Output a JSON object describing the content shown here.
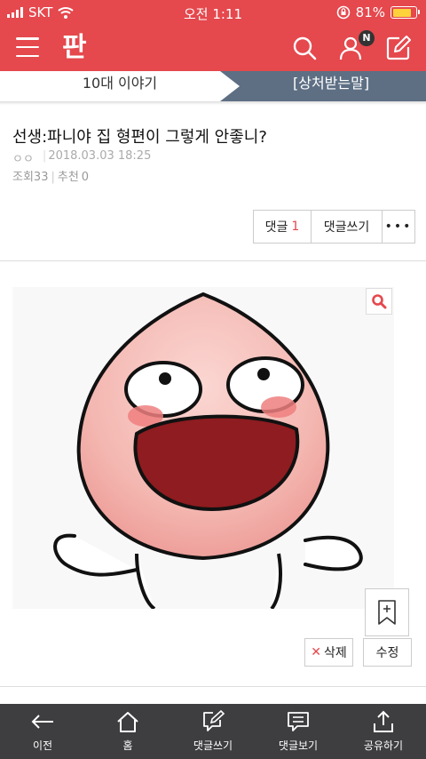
{
  "status_bar": {
    "carrier": "SKT",
    "time": "오전 1:11",
    "battery": "81%",
    "battery_level": 0.81
  },
  "header": {
    "logo": "판",
    "notification_badge": "N"
  },
  "category": {
    "left": "10대 이야기",
    "right": "[상처받는말]"
  },
  "post": {
    "title": "선생:파니야 집 형편이 그렇게 안좋니?",
    "author": "ㅇㅇ",
    "date": "2018.03.03 18:25",
    "views_label": "조회",
    "views": "33",
    "recommend_label": "추천",
    "recommend": "0"
  },
  "actions": {
    "comment_label": "댓글",
    "comment_count": "1",
    "write_label": "댓글쓰기",
    "more": "•••"
  },
  "post_buttons": {
    "delete": "삭제",
    "edit": "수정"
  },
  "toolbar": [
    {
      "label": "이전",
      "icon": "back-arrow-icon"
    },
    {
      "label": "홈",
      "icon": "home-icon"
    },
    {
      "label": "댓글쓰기",
      "icon": "write-comment-icon"
    },
    {
      "label": "댓글보기",
      "icon": "view-comments-icon"
    },
    {
      "label": "공유하기",
      "icon": "share-icon"
    }
  ],
  "colors": {
    "brand": "#e5484d",
    "category_active": "#5e6f84",
    "toolbar_bg": "#3e3e40"
  }
}
